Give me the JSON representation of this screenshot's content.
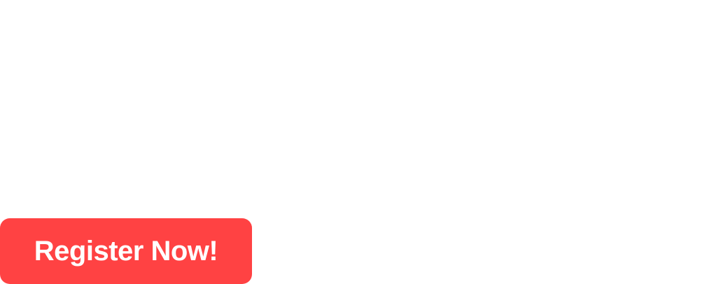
{
  "cta": {
    "register_label": "Register Now!",
    "background_color": "#ff4243",
    "text_color": "#ffffff"
  }
}
